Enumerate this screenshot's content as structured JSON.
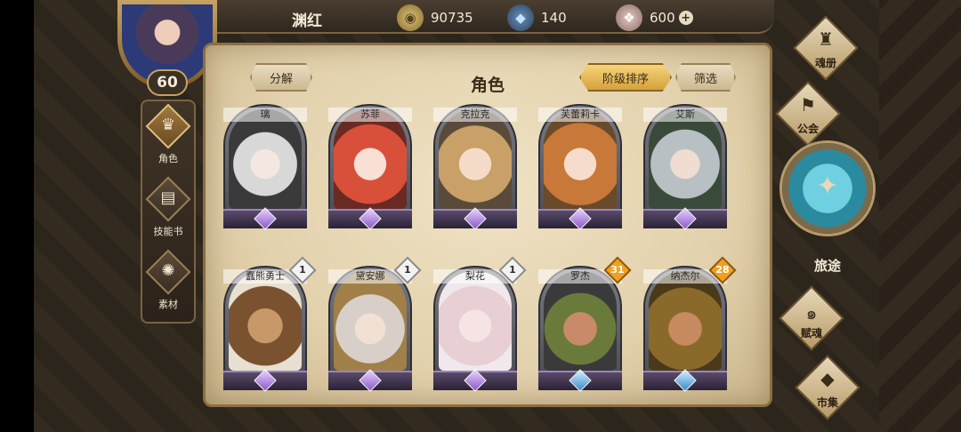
{
  "header": {
    "player_name": "渊红",
    "level": "60",
    "gold": "90735",
    "gems": "140",
    "crystals": "600",
    "plus": "+"
  },
  "left_nav": {
    "items": [
      {
        "label": "角色",
        "icon": "helmet-icon",
        "glyph": "♛"
      },
      {
        "label": "技能书",
        "icon": "book-icon",
        "glyph": "▤"
      },
      {
        "label": "素材",
        "icon": "beast-icon",
        "glyph": "✺"
      }
    ]
  },
  "panel": {
    "title": "角色",
    "decompose_label": "分解",
    "sort_label": "阶级排序",
    "filter_label": "筛选"
  },
  "heroes": {
    "row1": [
      {
        "name": "璃"
      },
      {
        "name": "苏菲"
      },
      {
        "name": "克拉克"
      },
      {
        "name": "芙蕾莉卡"
      },
      {
        "name": "艾斯"
      }
    ],
    "row2": [
      {
        "name": "蠢熊勇士",
        "count": "1"
      },
      {
        "name": "黛安娜",
        "count": "1"
      },
      {
        "name": "梨花",
        "count": "1"
      },
      {
        "name": "罗杰",
        "count": "31"
      },
      {
        "name": "纳杰尔",
        "count": "28"
      }
    ]
  },
  "right_nav": {
    "items": [
      {
        "label": "魂册",
        "icon": "soul-book-icon",
        "glyph": "♜"
      },
      {
        "label": "公会",
        "icon": "guild-icon",
        "glyph": "⚑"
      },
      {
        "label": "旅途",
        "icon": "journey-emblem-icon",
        "glyph": "✦"
      },
      {
        "label": "赋魂",
        "icon": "soul-swirl-icon",
        "glyph": "๑"
      },
      {
        "label": "市集",
        "icon": "market-icon",
        "glyph": "◆"
      }
    ]
  },
  "colors": {
    "gold_badge": "#f0a020",
    "parchment": "#e2d1ac",
    "accent_button": "#d4a23c"
  }
}
